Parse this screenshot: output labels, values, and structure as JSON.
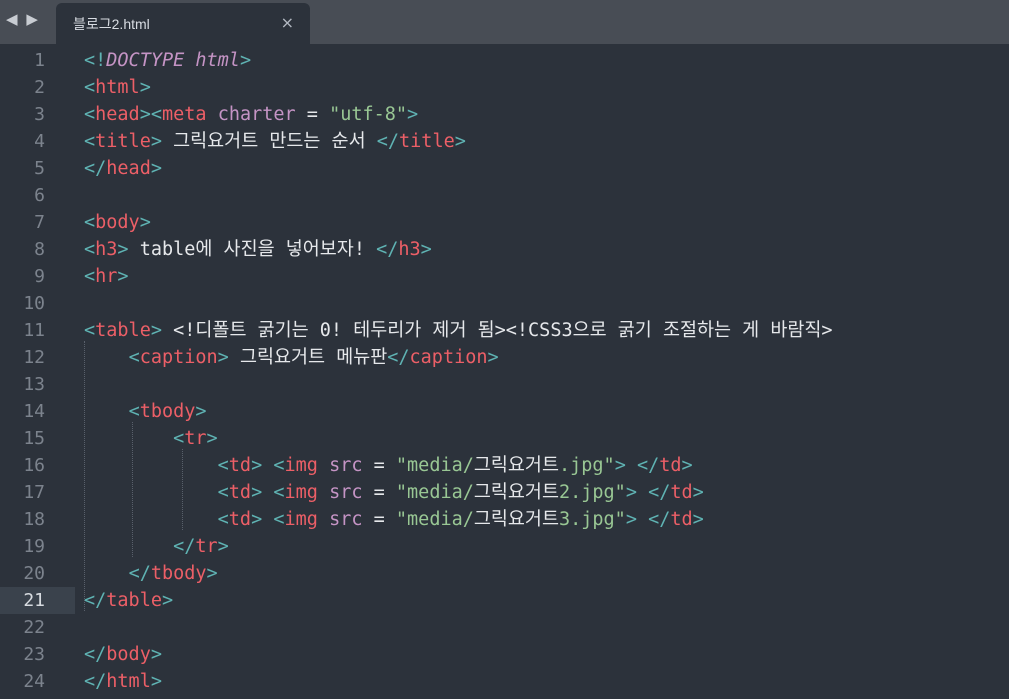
{
  "toolbar": {
    "nav_back_icon": "◀",
    "nav_forward_icon": "▶"
  },
  "tab": {
    "title": "블로그2.html",
    "close_icon": "×"
  },
  "editor": {
    "current_line": 21,
    "line_numbers": [
      "1",
      "2",
      "3",
      "4",
      "5",
      "6",
      "7",
      "8",
      "9",
      "10",
      "11",
      "12",
      "13",
      "14",
      "15",
      "16",
      "17",
      "18",
      "19",
      "20",
      "21",
      "22",
      "23",
      "24"
    ],
    "lines": [
      [
        [
          "p",
          "<!"
        ],
        [
          "k",
          "DOCTYPE"
        ],
        [
          "w",
          " "
        ],
        [
          "k",
          "html"
        ],
        [
          "p",
          ">"
        ]
      ],
      [
        [
          "p",
          "<"
        ],
        [
          "t",
          "html"
        ],
        [
          "p",
          ">"
        ]
      ],
      [
        [
          "p",
          "<"
        ],
        [
          "t",
          "head"
        ],
        [
          "p",
          "><"
        ],
        [
          "t",
          "meta"
        ],
        [
          "w",
          " "
        ],
        [
          "a",
          "charter"
        ],
        [
          "w",
          " = "
        ],
        [
          "s",
          "\"utf-8\""
        ],
        [
          "p",
          ">"
        ]
      ],
      [
        [
          "p",
          "<"
        ],
        [
          "t",
          "title"
        ],
        [
          "p",
          ">"
        ],
        [
          "w",
          " 그릭요거트 만드는 순서 "
        ],
        [
          "p",
          "</"
        ],
        [
          "t",
          "title"
        ],
        [
          "p",
          ">"
        ]
      ],
      [
        [
          "p",
          "</"
        ],
        [
          "t",
          "head"
        ],
        [
          "p",
          ">"
        ]
      ],
      [],
      [
        [
          "p",
          "<"
        ],
        [
          "t",
          "body"
        ],
        [
          "p",
          ">"
        ]
      ],
      [
        [
          "p",
          "<"
        ],
        [
          "t",
          "h3"
        ],
        [
          "p",
          ">"
        ],
        [
          "w",
          " table에 사진을 넣어보자! "
        ],
        [
          "p",
          "</"
        ],
        [
          "t",
          "h3"
        ],
        [
          "p",
          ">"
        ]
      ],
      [
        [
          "p",
          "<"
        ],
        [
          "t",
          "hr"
        ],
        [
          "p",
          ">"
        ]
      ],
      [],
      [
        [
          "p",
          "<"
        ],
        [
          "t",
          "table"
        ],
        [
          "p",
          ">"
        ],
        [
          "w",
          " <!디폴트 굵기는 0! 테두리가 제거 됨><!CSS3으로 굵기 조절하는 게 바람직>"
        ]
      ],
      [
        [
          "w",
          "    "
        ],
        [
          "p",
          "<"
        ],
        [
          "t",
          "caption"
        ],
        [
          "p",
          ">"
        ],
        [
          "w",
          " 그릭요거트 메뉴판"
        ],
        [
          "p",
          "</"
        ],
        [
          "t",
          "caption"
        ],
        [
          "p",
          ">"
        ]
      ],
      [],
      [
        [
          "w",
          "    "
        ],
        [
          "p",
          "<"
        ],
        [
          "t",
          "tbody"
        ],
        [
          "p",
          ">"
        ]
      ],
      [
        [
          "w",
          "        "
        ],
        [
          "p",
          "<"
        ],
        [
          "t",
          "tr"
        ],
        [
          "p",
          ">"
        ]
      ],
      [
        [
          "w",
          "            "
        ],
        [
          "p",
          "<"
        ],
        [
          "t",
          "td"
        ],
        [
          "p",
          "> <"
        ],
        [
          "t",
          "img"
        ],
        [
          "w",
          " "
        ],
        [
          "a",
          "src"
        ],
        [
          "w",
          " = "
        ],
        [
          "s",
          "\"media/"
        ],
        [
          "w",
          "그릭요거트"
        ],
        [
          "s",
          ".jpg\""
        ],
        [
          "p",
          "> </"
        ],
        [
          "t",
          "td"
        ],
        [
          "p",
          ">"
        ]
      ],
      [
        [
          "w",
          "            "
        ],
        [
          "p",
          "<"
        ],
        [
          "t",
          "td"
        ],
        [
          "p",
          "> <"
        ],
        [
          "t",
          "img"
        ],
        [
          "w",
          " "
        ],
        [
          "a",
          "src"
        ],
        [
          "w",
          " = "
        ],
        [
          "s",
          "\"media/"
        ],
        [
          "w",
          "그릭요거트"
        ],
        [
          "s",
          "2.jpg\""
        ],
        [
          "p",
          "> </"
        ],
        [
          "t",
          "td"
        ],
        [
          "p",
          ">"
        ]
      ],
      [
        [
          "w",
          "            "
        ],
        [
          "p",
          "<"
        ],
        [
          "t",
          "td"
        ],
        [
          "p",
          "> <"
        ],
        [
          "t",
          "img"
        ],
        [
          "w",
          " "
        ],
        [
          "a",
          "src"
        ],
        [
          "w",
          " = "
        ],
        [
          "s",
          "\"media/"
        ],
        [
          "w",
          "그릭요거트"
        ],
        [
          "s",
          "3.jpg\""
        ],
        [
          "p",
          "> </"
        ],
        [
          "t",
          "td"
        ],
        [
          "p",
          ">"
        ]
      ],
      [
        [
          "w",
          "        "
        ],
        [
          "p",
          "</"
        ],
        [
          "t",
          "tr"
        ],
        [
          "p",
          ">"
        ]
      ],
      [
        [
          "w",
          "    "
        ],
        [
          "p",
          "</"
        ],
        [
          "t",
          "tbody"
        ],
        [
          "p",
          ">"
        ]
      ],
      [
        [
          "p",
          "</"
        ],
        [
          "t",
          "table"
        ],
        [
          "p",
          ">"
        ]
      ],
      [],
      [
        [
          "p",
          "</"
        ],
        [
          "t",
          "body"
        ],
        [
          "p",
          ">"
        ]
      ],
      [
        [
          "p",
          "</"
        ],
        [
          "t",
          "html"
        ],
        [
          "p",
          ">"
        ]
      ]
    ]
  }
}
